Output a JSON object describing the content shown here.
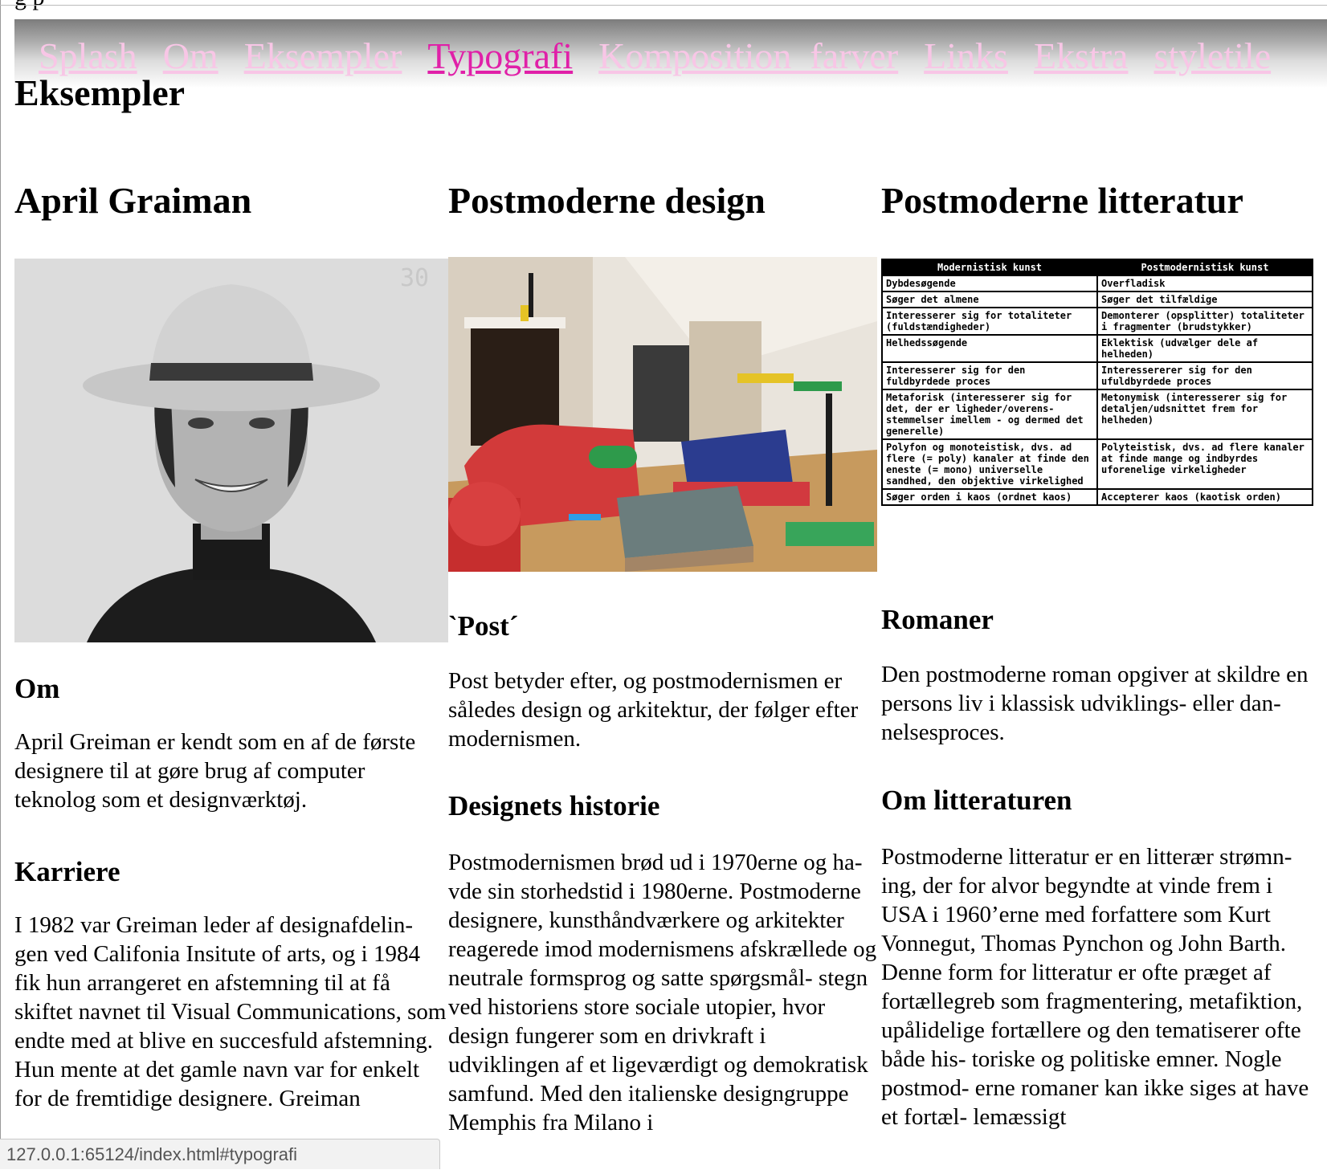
{
  "top_clipped": "g          p",
  "nav": {
    "items": [
      {
        "label": "Splash"
      },
      {
        "label": "Om"
      },
      {
        "label": "Eksempler"
      },
      {
        "label": "Typografi"
      },
      {
        "label": "Komposition  farver"
      },
      {
        "label": "Links"
      },
      {
        "label": "Ekstra"
      },
      {
        "label": "styletile"
      }
    ],
    "active_index": 3,
    "colors": {
      "link": "#f8c6e6",
      "active": "#e020a8"
    }
  },
  "page_title": "Eksempler",
  "columns": {
    "col1": {
      "heading": "April Graiman",
      "image_name": "april-greiman-portrait",
      "image_watermark": "30",
      "sections": [
        {
          "heading": "Om",
          "text": "April Greiman er kendt som en af de første designere til at gøre brug af computer teknolog som et designværktøj."
        },
        {
          "heading": "Karriere",
          "text": "I 1982 var Greiman leder af designafdelin- gen ved Califonia Insitute of arts, og i 1984 fik hun arrangeret en afstemning til at få skiftet navnet til Visual Communications, som endte med at blive en succesfuld afstemning. Hun mente at det gamle navn var for enkelt for de fremtidige designere. Greiman"
        }
      ]
    },
    "col2": {
      "heading": "Postmoderne design",
      "image_name": "memphis-interior-photo",
      "sections": [
        {
          "heading": "`Post´",
          "text": "Post betyder efter, og postmodernismen er således design og arkitektur, der følger efter modernismen."
        },
        {
          "heading": "Designets historie",
          "text": "Postmodernismen brød ud i 1970erne og ha- vde sin storhedstid i 1980erne. Postmoderne designere, kunsthåndværkere og arkitekter reagerede imod modernismens afskrællede og neutrale formsprog og satte spørgsmål- stegn ved historiens store sociale utopier, hvor design fungerer som en drivkraft i udviklingen af et ligeværdigt og demokratisk samfund. Med den italienske designgruppe Memphis fra Milano i"
        }
      ]
    },
    "col3": {
      "heading": "Postmoderne litteratur",
      "table": {
        "headers": [
          "Modernistisk kunst",
          "Postmodernistisk kunst"
        ],
        "rows": [
          [
            "Dybdesøgende",
            "Overfladisk"
          ],
          [
            "Søger det almene",
            "Søger det tilfældige"
          ],
          [
            "Interesserer sig for totaliteter (fuldstændigheder)",
            "Demonterer (opsplitter) totaliteter i fragmenter (brudstykker)"
          ],
          [
            "Helhedssøgende",
            "Eklektisk (udvælger dele af helheden)"
          ],
          [
            "Interesserer sig for den fuldbyrdede proces",
            "Interessererer sig for den ufuldbyrdede proces"
          ],
          [
            "Metaforisk (interesserer sig for det, der er ligheder/overens- stemmelser imellem - og dermed det generelle)",
            "Metonymisk (interesserer sig for detaljen/udsnittet frem for helheden)"
          ],
          [
            "Polyfon og monoteistisk, dvs. ad flere (= poly) kanaler at finde den eneste (= mono) universelle sandhed, den objektive virkelighed",
            "Polyteistisk, dvs. ad flere kanaler at finde mange og indbyrdes uforenelige virkeligheder"
          ],
          [
            "Søger orden i kaos (ordnet kaos)",
            "Accepterer kaos (kaotisk orden)"
          ]
        ]
      },
      "sections": [
        {
          "heading": "Romaner",
          "text": "Den postmoderne roman opgiver at skildre en persons liv i klassisk udviklings- eller dan- nelsesproces."
        },
        {
          "heading": "Om litteraturen",
          "text": "Postmoderne litteratur er en litterær strømn- ing, der for alvor begyndte at vinde frem i USA i 1960’erne med forfattere som Kurt Vonnegut, Thomas Pynchon og John Barth. Denne form for litteratur er ofte præget af fortællegreb som fragmentering, metafiktion, upålidelige fortællere og den tematiserer ofte både his- toriske og politiske emner. Nogle postmod- erne romaner kan ikke siges at have et fortæl- lemæssigt"
        }
      ]
    }
  },
  "status_url": "127.0.0.1:65124/index.html#typografi"
}
